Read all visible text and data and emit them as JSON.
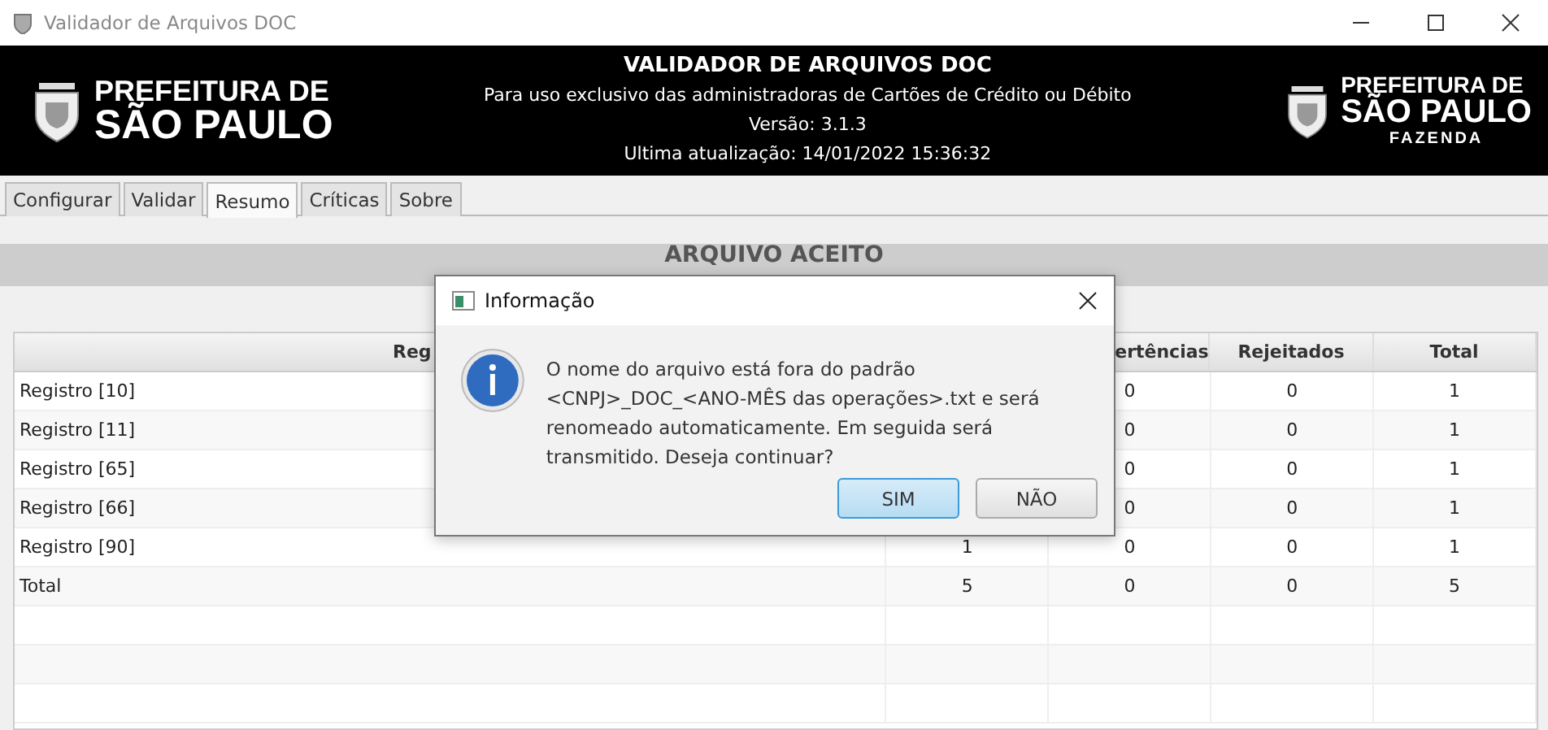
{
  "window": {
    "title": "Validador de Arquivos DOC"
  },
  "header": {
    "logo_left": [
      "PREFEITURA DE",
      "SÃO PAULO"
    ],
    "title": "VALIDADOR DE ARQUIVOS DOC",
    "lines": [
      "Para uso exclusivo das administradoras de Cartões de Crédito ou Débito",
      "Versão: 3.1.3",
      "Ultima atualização: 14/01/2022 15:36:32"
    ],
    "logo_right": [
      "PREFEITURA DE",
      "SÃO PAULO",
      "FAZENDA"
    ]
  },
  "tabs": [
    {
      "label": "Configurar",
      "selected": false
    },
    {
      "label": "Validar",
      "selected": false
    },
    {
      "label": "Resumo",
      "selected": true
    },
    {
      "label": "Críticas",
      "selected": false
    },
    {
      "label": "Sobre",
      "selected": false
    }
  ],
  "banner": "ARQUIVO ACEITO",
  "table": {
    "columns": [
      "Reg",
      "ertências",
      "Rejeitados",
      "Total"
    ],
    "rows": [
      {
        "label": "Registro [10]",
        "values": [
          "0",
          "0",
          "1"
        ]
      },
      {
        "label": "Registro [11]",
        "values": [
          "0",
          "0",
          "1"
        ]
      },
      {
        "label": "Registro [65]",
        "values": [
          "0",
          "0",
          "1"
        ]
      },
      {
        "label": "Registro [66]",
        "values": [
          "0",
          "0",
          "1"
        ]
      },
      {
        "label": "Registro [90]",
        "values": [
          "1",
          "0",
          "0",
          "1"
        ]
      },
      {
        "label": "Total",
        "values": [
          "5",
          "0",
          "0",
          "5"
        ]
      }
    ]
  },
  "dialog": {
    "title": "Informação",
    "message": "O nome do arquivo está fora do padrão <CNPJ>_DOC_<ANO-MÊS das operações>.txt e será renomeado automaticamente. Em seguida será transmitido. Deseja continuar?",
    "buttons": [
      {
        "label": "SIM",
        "selected": true
      },
      {
        "label": "NÃO",
        "selected": false
      }
    ]
  }
}
